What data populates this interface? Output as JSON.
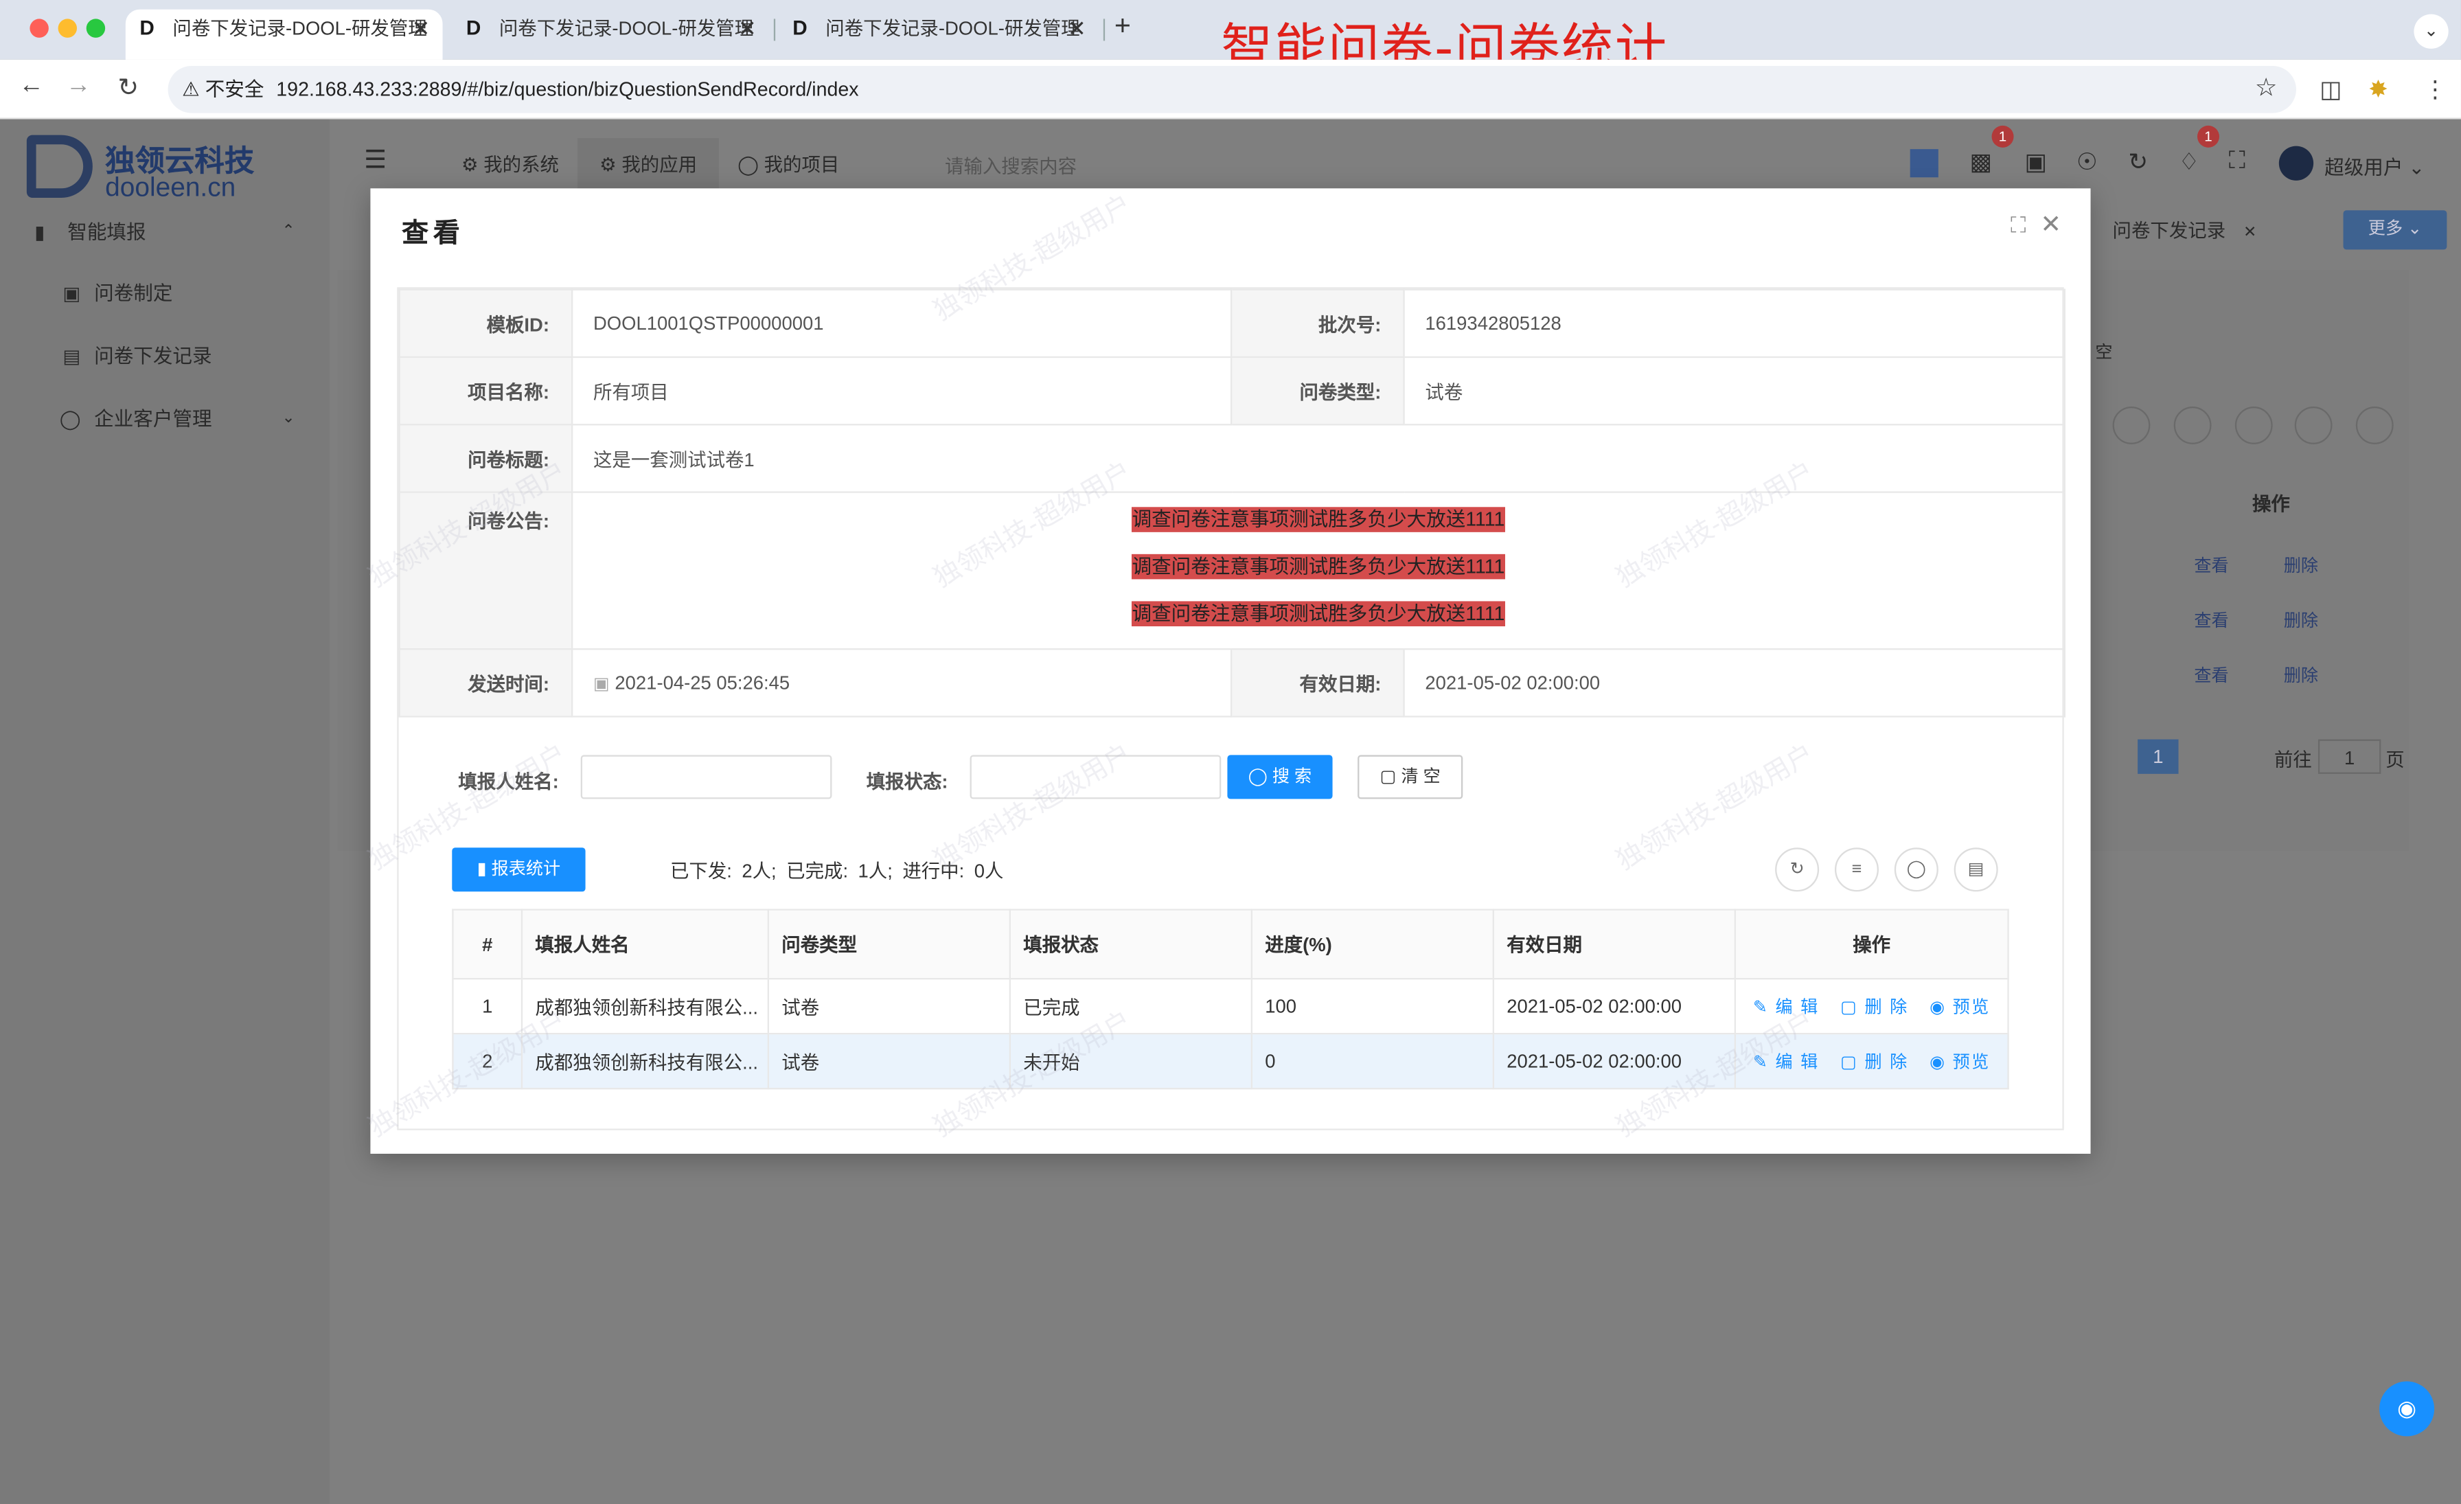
{
  "browser": {
    "tabs": [
      {
        "title": "问卷下发记录-DOOL-研发管理",
        "close": "✕"
      },
      {
        "title": "问卷下发记录-DOOL-研发管理",
        "close": "✕"
      },
      {
        "title": "问卷下发记录-DOOL-研发管理",
        "close": "✕"
      }
    ],
    "new_tab": "+",
    "overlay_title": "智能问卷-问卷统计",
    "security": "不安全",
    "url": "192.168.43.233:2889/#/biz/question/bizQuestionSendRecord/index"
  },
  "sidebar": {
    "logo_cn": "独领云科技",
    "logo_en": "dooleen.cn",
    "items": [
      {
        "label": "智能填报",
        "icon": "bar-chart-icon"
      },
      {
        "label": "问卷制定",
        "icon": "wallet-icon"
      },
      {
        "label": "问卷下发记录",
        "icon": "record-icon"
      },
      {
        "label": "企业客户管理",
        "icon": "user-icon"
      }
    ]
  },
  "topnav": {
    "items": [
      "我的系统",
      "我的应用",
      "我的项目"
    ],
    "search_placeholder": "请输入搜索内容",
    "badge1": "1",
    "badge2": "1",
    "username": "超级用户",
    "tag": "问卷下发记录",
    "more": "更多"
  },
  "background": {
    "column_header": "操作",
    "op_view": "查看",
    "op_delete": "删除",
    "clear": "空",
    "page": "1",
    "goto": "前往",
    "page_input": "1",
    "page_unit": "页"
  },
  "modal": {
    "title": "查看",
    "fields": {
      "template_id_label": "模板ID:",
      "template_id": "DOOL1001QSTP00000001",
      "batch_label": "批次号:",
      "batch": "1619342805128",
      "project_label": "项目名称:",
      "project": "所有项目",
      "qtype_label": "问卷类型:",
      "qtype": "试卷",
      "qtitle_label": "问卷标题:",
      "qtitle": "这是一套测试试卷1",
      "notice_label": "问卷公告:",
      "notice_lines": [
        "调查问卷注意事项测试胜多负少大放送1111",
        "调查问卷注意事项测试胜多负少大放送1111",
        "调查问卷注意事项测试胜多负少大放送1111"
      ],
      "send_time_label": "发送时间:",
      "send_time": "2021-04-25 05:26:45",
      "valid_date_label": "有效日期:",
      "valid_date": "2021-05-02 02:00:00"
    },
    "filter": {
      "name_label": "填报人姓名:",
      "status_label": "填报状态:",
      "search": "搜 索",
      "clear": "清 空"
    },
    "report_btn": "报表统计",
    "stats": "已下发: 2人; 已完成: 1人; 进行中: 0人",
    "table": {
      "headers": [
        "#",
        "填报人姓名",
        "问卷类型",
        "填报状态",
        "进度(%)",
        "有效日期",
        "操作"
      ],
      "rows": [
        {
          "no": "1",
          "name": "成都独领创新科技有限公...",
          "type": "试卷",
          "status": "已完成",
          "progress": "100",
          "date": "2021-05-02 02:00:00"
        },
        {
          "no": "2",
          "name": "成都独领创新科技有限公...",
          "type": "试卷",
          "status": "未开始",
          "progress": "0",
          "date": "2021-05-02 02:00:00"
        }
      ],
      "op_edit": "编 辑",
      "op_delete": "删 除",
      "op_preview": "预览"
    },
    "watermark": "独领科技-超级用户"
  },
  "colors": {
    "primary": "#1890ff",
    "notice_bg": "#d44c4c",
    "title_red": "#e0211b"
  }
}
